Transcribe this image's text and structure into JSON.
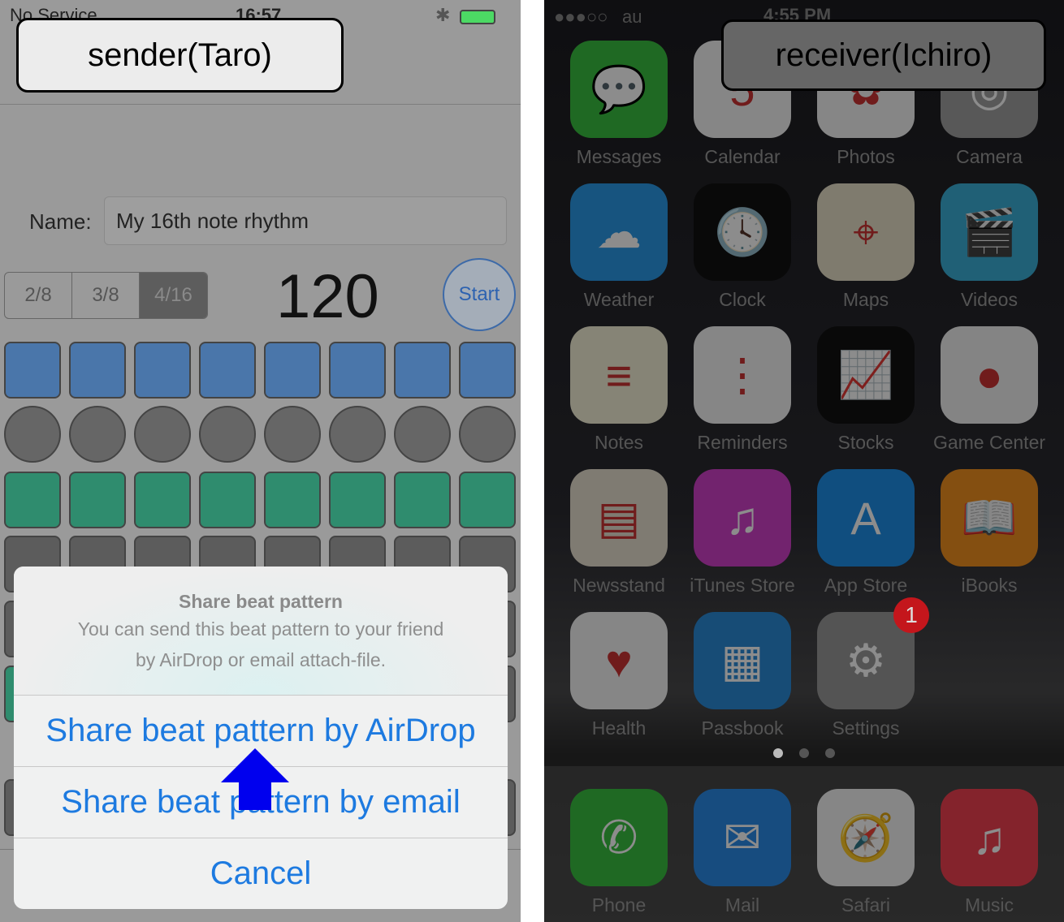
{
  "sender": {
    "callout": "sender(Taro)",
    "status": {
      "carrier": "No Service",
      "time": "16:57"
    },
    "name_label": "Name:",
    "name_value": "My 16th note rhythm",
    "segments": [
      {
        "label": "2/8",
        "selected": false
      },
      {
        "label": "3/8",
        "selected": false
      },
      {
        "label": "4/16",
        "selected": true
      }
    ],
    "tempo": "120",
    "start_label": "Start",
    "grid_rows": [
      {
        "shape": "square",
        "color": "#4a76aa"
      },
      {
        "shape": "circle",
        "color": "#666666"
      },
      {
        "shape": "square",
        "color": "#2f8c6e"
      },
      {
        "shape": "square",
        "color": "#5c5c5c"
      },
      {
        "shape": "square",
        "color": "#5c5c5c"
      },
      {
        "shape": "square",
        "color": "#5c5c5c"
      },
      {
        "shape": "square",
        "color": "#5c5c5c"
      }
    ],
    "sheet": {
      "title": "Share beat pattern",
      "message_line1": "You can send this beat pattern to your friend",
      "message_line2": "by AirDrop or email attach-file.",
      "buttons": [
        "Share beat pattern by AirDrop",
        "Share beat pattern by email",
        "Cancel"
      ]
    },
    "accent": "#1d7ae0",
    "arrow_color": "#0000ee"
  },
  "receiver": {
    "callout": "receiver(Ichiro)",
    "status": {
      "carrier": "au",
      "time": "4:55 PM"
    },
    "apps": [
      {
        "label": "Messages",
        "color": "#3ac040",
        "icon": "speech-bubble"
      },
      {
        "label": "Calendar",
        "color": "#f4f4f4",
        "icon": "calendar"
      },
      {
        "label": "Photos",
        "color": "#f4f4f4",
        "icon": "flower"
      },
      {
        "label": "Camera",
        "color": "#a0a0a0",
        "icon": "camera"
      },
      {
        "label": "Weather",
        "color": "#2a9ae8",
        "icon": "cloud-sun"
      },
      {
        "label": "Clock",
        "color": "#111111",
        "icon": "clock"
      },
      {
        "label": "Maps",
        "color": "#e8e0c8",
        "icon": "map"
      },
      {
        "label": "Videos",
        "color": "#3bb0d8",
        "icon": "clapperboard"
      },
      {
        "label": "Notes",
        "color": "#f4f0d8",
        "icon": "notepad"
      },
      {
        "label": "Reminders",
        "color": "#f4f4f4",
        "icon": "list"
      },
      {
        "label": "Stocks",
        "color": "#111111",
        "icon": "stock-chart"
      },
      {
        "label": "Game Center",
        "color": "#f0f0f0",
        "icon": "bubbles"
      },
      {
        "label": "Newsstand",
        "color": "#e8e0d0",
        "icon": "magazines"
      },
      {
        "label": "iTunes Store",
        "color": "#d040c8",
        "icon": "music-note"
      },
      {
        "label": "App Store",
        "color": "#1e8ee8",
        "icon": "app-store"
      },
      {
        "label": "iBooks",
        "color": "#f09020",
        "icon": "book"
      },
      {
        "label": "Health",
        "color": "#f4f4f4",
        "icon": "heart"
      },
      {
        "label": "Passbook",
        "color": "#2a8ad8",
        "icon": "tickets"
      },
      {
        "label": "Settings",
        "color": "#9a9a9a",
        "icon": "gear",
        "badge": "1"
      }
    ],
    "dock": [
      {
        "label": "Phone",
        "color": "#3ac040",
        "icon": "phone"
      },
      {
        "label": "Mail",
        "color": "#2a8ae8",
        "icon": "envelope"
      },
      {
        "label": "Safari",
        "color": "#f4f4f4",
        "icon": "compass"
      },
      {
        "label": "Music",
        "color": "#f04050",
        "icon": "music-note"
      }
    ],
    "page_count": 3,
    "current_page": 1
  }
}
